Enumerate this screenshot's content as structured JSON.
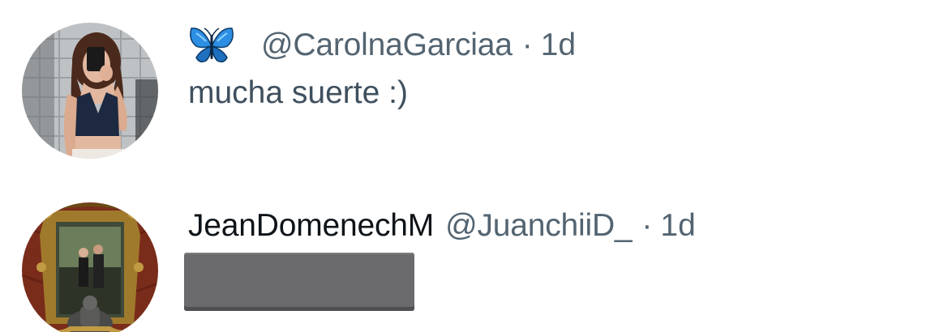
{
  "replies": [
    {
      "display_name": "",
      "handle": "@CarolnaGarciaa",
      "separator": "·",
      "time": "1d",
      "text": "mucha suerte :)",
      "badge_icon": "blue-butterfly-emoji",
      "avatar_icon": "profile-photo-mirror-selfie"
    },
    {
      "display_name": "JeanDomenechM",
      "handle": "@JuanchiiD_",
      "separator": "·",
      "time": "1d",
      "text": "",
      "text_redacted": true,
      "avatar_icon": "profile-photo-ornate-frame"
    }
  ],
  "colors": {
    "name": "#0f1419",
    "muted": "#536471",
    "body": "#3f4f5e",
    "redaction": "#6b6b6d",
    "background": "#ffffff"
  }
}
